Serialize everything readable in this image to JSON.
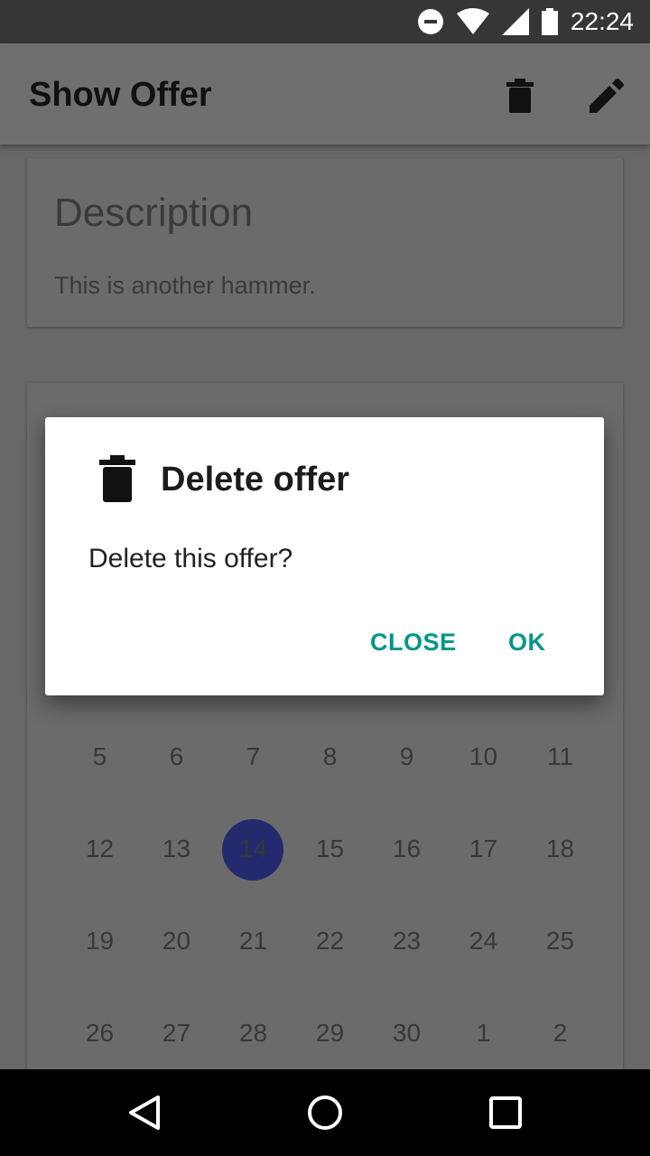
{
  "status_bar": {
    "time": "22:24"
  },
  "app_bar": {
    "title": "Show Offer",
    "delete_icon": "trash-icon",
    "edit_icon": "pencil-icon"
  },
  "description_card": {
    "heading": "Description",
    "body": "This is another hammer."
  },
  "calendar": {
    "weeks": [
      [
        "5",
        "6",
        "7",
        "8",
        "9",
        "10",
        "11"
      ],
      [
        "12",
        "13",
        "14",
        "15",
        "16",
        "17",
        "18"
      ],
      [
        "19",
        "20",
        "21",
        "22",
        "23",
        "24",
        "25"
      ],
      [
        "26",
        "27",
        "28",
        "29",
        "30",
        "1",
        "2"
      ]
    ],
    "selected_day": "14",
    "selected_color": "#232a6e"
  },
  "dialog": {
    "icon": "trash-icon",
    "title": "Delete offer",
    "message": "Delete this offer?",
    "close_label": "CLOSE",
    "ok_label": "OK",
    "accent_color": "#00968a"
  },
  "nav_bar": {
    "back_icon": "back-triangle-icon",
    "home_icon": "home-circle-icon",
    "recents_icon": "recents-square-icon"
  }
}
